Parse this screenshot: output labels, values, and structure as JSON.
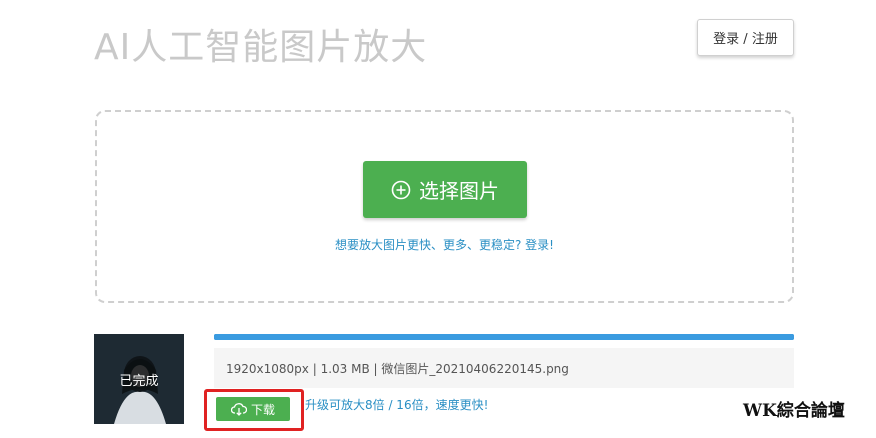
{
  "header": {
    "title": "AI人工智能图片放大",
    "login_label": "登录 / 注册"
  },
  "upload": {
    "select_label": "选择图片",
    "hint": "想要放大图片更快、更多、更稳定? 登录!"
  },
  "result": {
    "status": "已完成",
    "progress": 1.0,
    "file_info": "1920x1080px | 1.03 MB | 微信图片_20210406220145.png",
    "download_label": "下载",
    "upgrade_text": "升级可放大8倍 / 16倍，速度更快!"
  },
  "watermark": "WK綜合論壇",
  "colors": {
    "accent_green": "#4caf50",
    "link_blue": "#2a8fc4",
    "progress_blue": "#3a9be0",
    "highlight_red": "#e02222"
  }
}
